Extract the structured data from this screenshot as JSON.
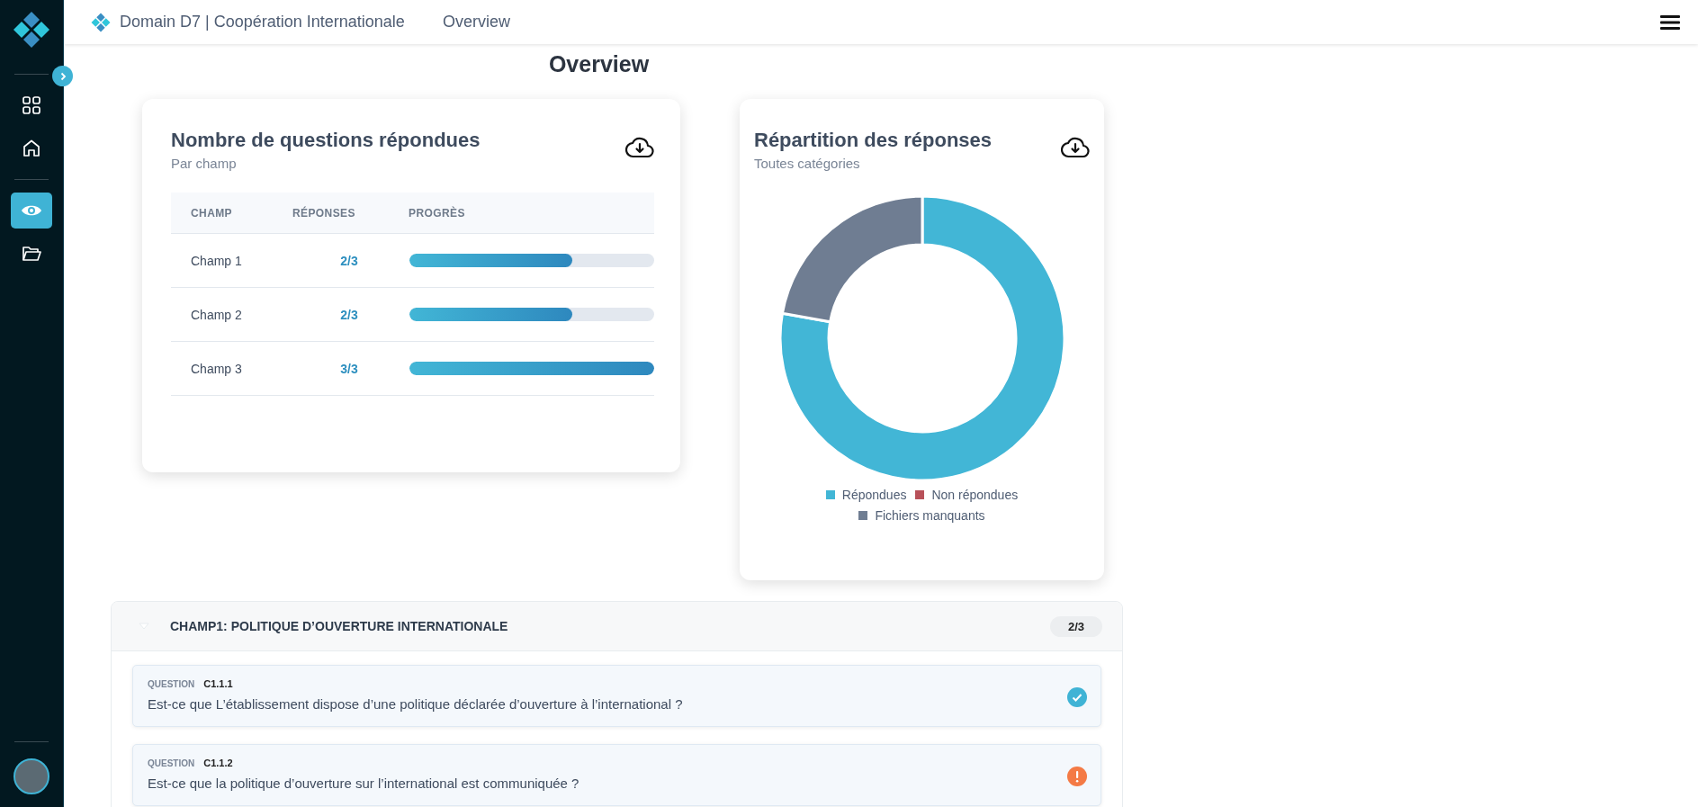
{
  "sidebar": {
    "items": [
      {
        "selected": false
      },
      {
        "selected": false
      },
      {
        "selected": true
      },
      {
        "selected": false
      }
    ]
  },
  "header": {
    "title": "Domain D7 | Coopération Internationale",
    "breadcrumb": "Overview"
  },
  "page_title": "Overview",
  "progress_card": {
    "title": "Nombre de questions répondues",
    "subtitle": "Par champ",
    "table": {
      "columns": [
        "CHAMP",
        "RÉPONSES",
        "PROGRÈS"
      ],
      "rows": [
        {
          "champ": "Champ 1",
          "reponses": "2/3",
          "level": 0.667
        },
        {
          "champ": "Champ 2",
          "reponses": "2/3",
          "level": 0.667
        },
        {
          "champ": "Champ 3",
          "reponses": "3/3",
          "level": 1
        }
      ]
    }
  },
  "distribution_card": {
    "title": "Répartition des réponses",
    "subtitle": "Toutes catégories",
    "chart_data": {
      "type": "donut",
      "categories": [
        "Répondues",
        "Non répondues",
        "Fichiers manquants"
      ],
      "values": [
        77.8,
        0,
        22.2
      ],
      "colors": [
        "#42b6d6",
        "#b85159",
        "#6f7d92"
      ],
      "legend": "bottom"
    }
  },
  "section": {
    "title": "CHAMP1: POLITIQUE D’OUVERTURE INTERNATIONALE",
    "count": "2/3",
    "expanded": true,
    "questions": [
      {
        "label": "QUESTION",
        "code": "C1.1.1",
        "text": "Est-ce que L’établissement dispose d’une politique déclarée d’ouverture à l’international ?",
        "kind": "answered"
      },
      {
        "label": "QUESTION",
        "code": "C1.1.2",
        "text": "Est-ce que la politique d’ouverture sur l’international est communiquée ?",
        "kind": "warning"
      }
    ]
  }
}
